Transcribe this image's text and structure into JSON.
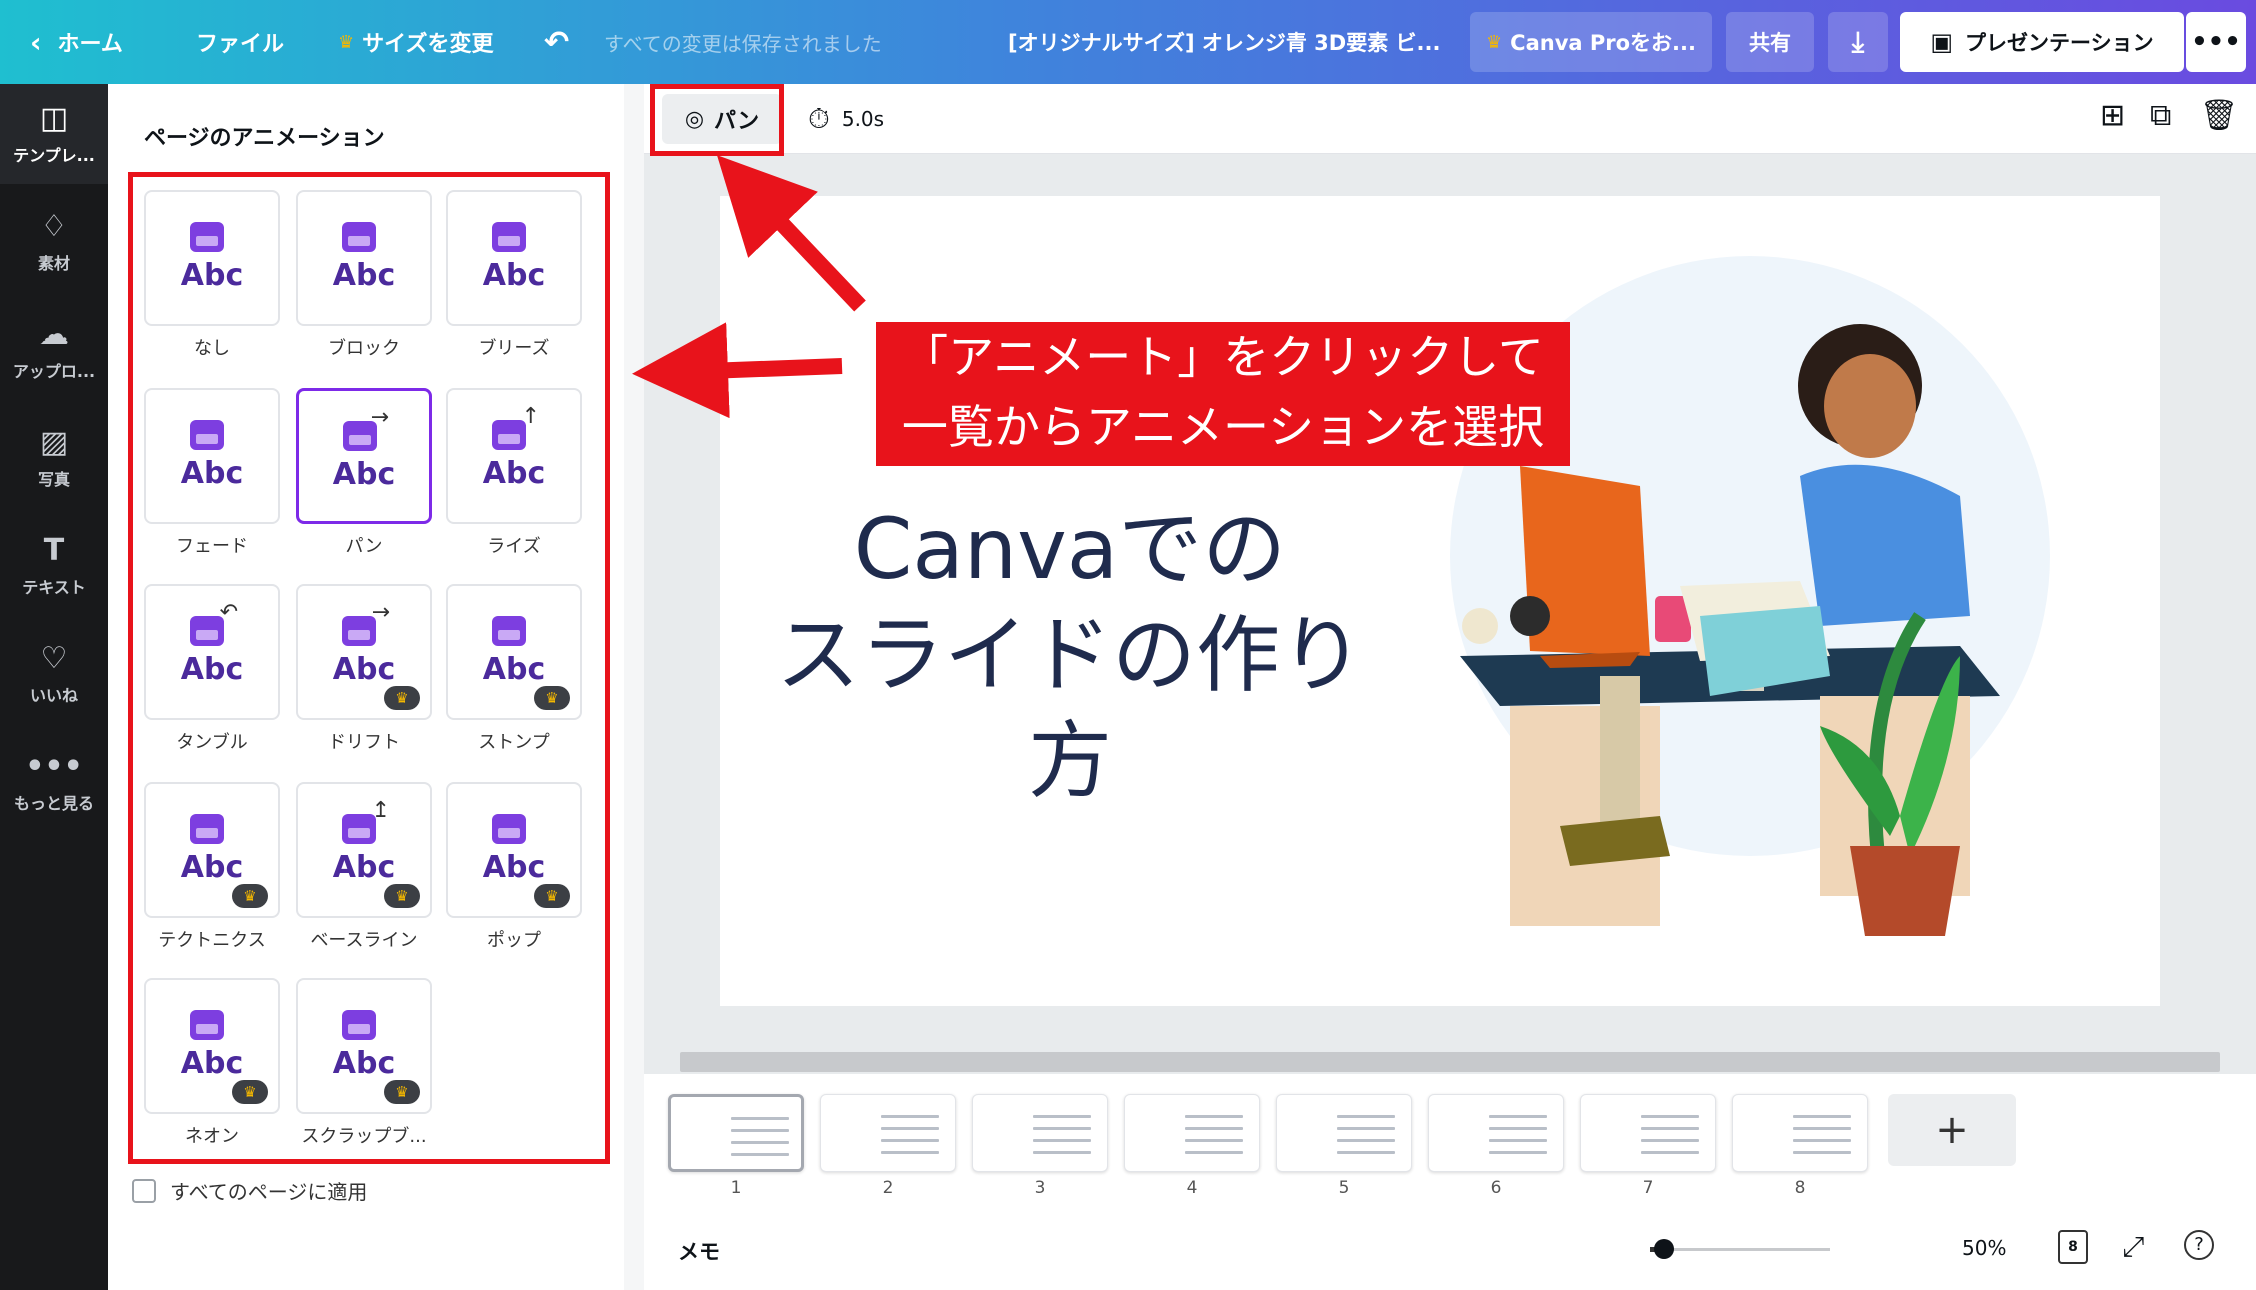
{
  "topbar": {
    "home": "ホーム",
    "file": "ファイル",
    "resize": "サイズを変更",
    "saved_status": "すべての変更は保存されました",
    "doc_title": "[オリジナルサイズ] オレンジ青 3D要素 ビ...",
    "pro": "Canva Proをお...",
    "share": "共有",
    "present": "プレゼンテーション"
  },
  "rail": [
    {
      "label": "テンプレ...",
      "icon": "template-icon"
    },
    {
      "label": "素材",
      "icon": "elements-icon"
    },
    {
      "label": "アップロ...",
      "icon": "upload-icon"
    },
    {
      "label": "写真",
      "icon": "photo-icon"
    },
    {
      "label": "テキスト",
      "icon": "text-icon"
    },
    {
      "label": "いいね",
      "icon": "heart-icon"
    },
    {
      "label": "もっと見る",
      "icon": "more-icon"
    }
  ],
  "panel": {
    "title": "ページのアニメーション",
    "apply_all": "すべてのページに適用",
    "sample_text": "Abc",
    "animations": [
      {
        "name": "なし",
        "pro": false
      },
      {
        "name": "ブロック",
        "pro": false
      },
      {
        "name": "ブリーズ",
        "pro": false
      },
      {
        "name": "フェード",
        "pro": false
      },
      {
        "name": "パン",
        "pro": false,
        "selected": true
      },
      {
        "name": "ライズ",
        "pro": false
      },
      {
        "name": "タンブル",
        "pro": false
      },
      {
        "name": "ドリフト",
        "pro": true
      },
      {
        "name": "ストンプ",
        "pro": true
      },
      {
        "name": "テクトニクス",
        "pro": true
      },
      {
        "name": "ベースライン",
        "pro": true
      },
      {
        "name": "ポップ",
        "pro": true
      },
      {
        "name": "ネオン",
        "pro": true
      },
      {
        "name": "スクラップブ...",
        "pro": true
      }
    ]
  },
  "editor": {
    "animate_button": "パン",
    "duration": "5.0s",
    "slide_title_line1": "Canvaでの",
    "slide_title_line2": "スライドの作り方"
  },
  "callout": {
    "line1": "「アニメート」をクリックして",
    "line2": "一覧からアニメーションを選択"
  },
  "pages": [
    "1",
    "2",
    "3",
    "4",
    "5",
    "6",
    "7",
    "8"
  ],
  "bottombar": {
    "memo": "メモ",
    "zoom": "50%",
    "page_count": "8"
  },
  "colors": {
    "accent": "#7d2ae8",
    "annotation": "#e8131b",
    "slide_title": "#1f2b4d"
  }
}
